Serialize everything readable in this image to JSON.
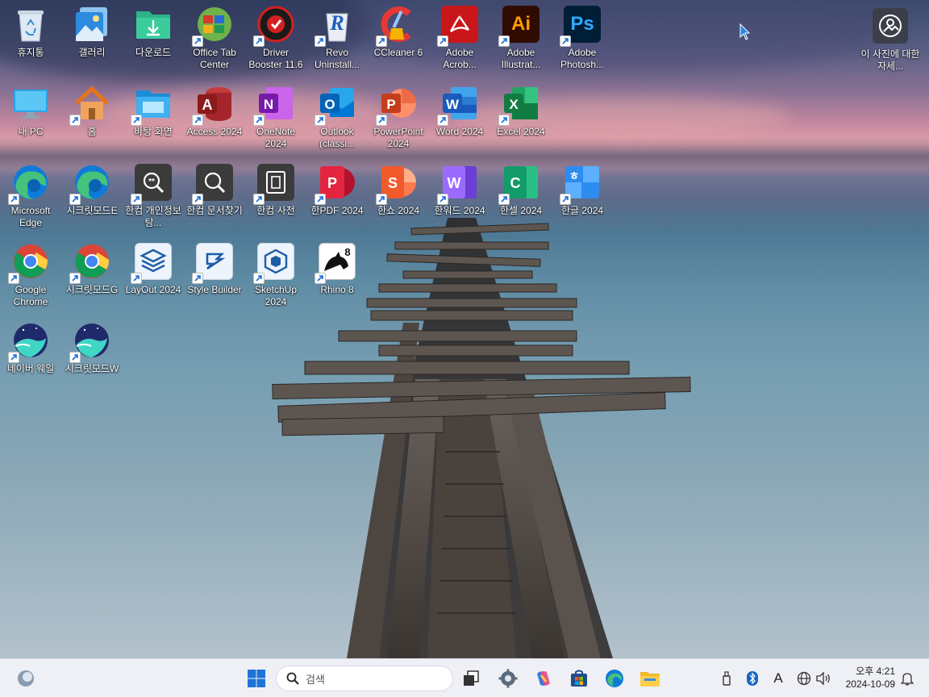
{
  "desktop": {
    "icons": [
      {
        "label": "휴지통",
        "icon": "recycle-bin-icon",
        "shortcut": false
      },
      {
        "label": "갤러리",
        "icon": "gallery-icon",
        "shortcut": false
      },
      {
        "label": "다운로드",
        "icon": "downloads-folder-icon",
        "shortcut": false
      },
      {
        "label": "Office Tab Center",
        "icon": "office-tab-icon",
        "shortcut": true
      },
      {
        "label": "Driver Booster 11.6",
        "icon": "driver-booster-icon",
        "shortcut": true
      },
      {
        "label": "Revo Uninstall...",
        "icon": "revo-uninstaller-icon",
        "shortcut": true
      },
      {
        "label": "CCleaner 6",
        "icon": "ccleaner-icon",
        "shortcut": true
      },
      {
        "label": "Adobe Acrob...",
        "icon": "adobe-acrobat-icon",
        "shortcut": true
      },
      {
        "label": "Adobe Illustrat...",
        "icon": "adobe-illustrator-icon",
        "shortcut": true
      },
      {
        "label": "Adobe Photosh...",
        "icon": "adobe-photoshop-icon",
        "shortcut": true
      },
      {
        "label": "내 PC",
        "icon": "this-pc-icon",
        "shortcut": false
      },
      {
        "label": "홈",
        "icon": "home-icon",
        "shortcut": true
      },
      {
        "label": "바탕 화면",
        "icon": "desktop-folder-icon",
        "shortcut": true
      },
      {
        "label": "Access 2024",
        "icon": "access-icon",
        "shortcut": true
      },
      {
        "label": "OneNote 2024",
        "icon": "onenote-icon",
        "shortcut": true
      },
      {
        "label": "Outlook (classi...",
        "icon": "outlook-icon",
        "shortcut": true
      },
      {
        "label": "PowerPoint 2024",
        "icon": "powerpoint-icon",
        "shortcut": true
      },
      {
        "label": "Word 2024",
        "icon": "word-icon",
        "shortcut": true
      },
      {
        "label": "Excel 2024",
        "icon": "excel-icon",
        "shortcut": true
      },
      {
        "label": "Microsoft Edge",
        "icon": "edge-icon",
        "shortcut": true
      },
      {
        "label": "시크릿모드E",
        "icon": "edge-icon",
        "shortcut": true
      },
      {
        "label": "한컴 개인정보탐...",
        "icon": "hancom-privacy-icon",
        "shortcut": true
      },
      {
        "label": "한컴 문서찾기",
        "icon": "hancom-search-icon",
        "shortcut": true
      },
      {
        "label": "한컴 사전",
        "icon": "hancom-dictionary-icon",
        "shortcut": true
      },
      {
        "label": "한PDF 2024",
        "icon": "hancom-pdf-icon",
        "shortcut": true
      },
      {
        "label": "한쇼 2024",
        "icon": "hanshow-icon",
        "shortcut": true
      },
      {
        "label": "한워드 2024",
        "icon": "hanword-icon",
        "shortcut": true
      },
      {
        "label": "한셀 2024",
        "icon": "hancell-icon",
        "shortcut": true
      },
      {
        "label": "한글 2024",
        "icon": "hangul-icon",
        "shortcut": true
      },
      {
        "label": "Google Chrome",
        "icon": "chrome-icon",
        "shortcut": true
      },
      {
        "label": "시크릿모드G",
        "icon": "chrome-icon",
        "shortcut": true
      },
      {
        "label": "LayOut 2024",
        "icon": "layout-icon",
        "shortcut": true
      },
      {
        "label": "Style Builder",
        "icon": "style-builder-icon",
        "shortcut": true
      },
      {
        "label": "SketchUp 2024",
        "icon": "sketchup-icon",
        "shortcut": true
      },
      {
        "label": "Rhino 8",
        "icon": "rhino-icon",
        "shortcut": true
      },
      {
        "label": "네이버 웨일",
        "icon": "whale-icon",
        "shortcut": true
      },
      {
        "label": "시크릿모드W",
        "icon": "whale-icon",
        "shortcut": true
      }
    ],
    "photo_info": {
      "label": "이 사진에 대한 자세...",
      "icon": "photo-info-icon"
    }
  },
  "taskbar": {
    "search_placeholder": "검색",
    "clock_time": "오후 4:21",
    "clock_date": "2024-10-09",
    "pinned": [
      "widgets-icon",
      "start-icon",
      "task-view-icon",
      "settings-icon",
      "copilot-icon",
      "store-icon",
      "edge-icon",
      "file-explorer-icon"
    ],
    "tray": [
      "usb-icon",
      "bluetooth-icon",
      "ime-icon",
      "network-icon",
      "volume-icon",
      "notification-bell-icon"
    ],
    "ime_label": "A"
  }
}
